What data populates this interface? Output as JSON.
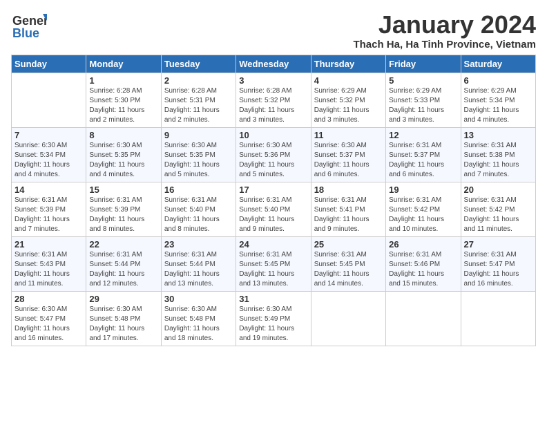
{
  "header": {
    "logo_line1": "General",
    "logo_line2": "Blue",
    "month_title": "January 2024",
    "location": "Thach Ha, Ha Tinh Province, Vietnam"
  },
  "weekdays": [
    "Sunday",
    "Monday",
    "Tuesday",
    "Wednesday",
    "Thursday",
    "Friday",
    "Saturday"
  ],
  "weeks": [
    [
      {
        "day": "",
        "info": ""
      },
      {
        "day": "1",
        "info": "Sunrise: 6:28 AM\nSunset: 5:30 PM\nDaylight: 11 hours\nand 2 minutes."
      },
      {
        "day": "2",
        "info": "Sunrise: 6:28 AM\nSunset: 5:31 PM\nDaylight: 11 hours\nand 2 minutes."
      },
      {
        "day": "3",
        "info": "Sunrise: 6:28 AM\nSunset: 5:32 PM\nDaylight: 11 hours\nand 3 minutes."
      },
      {
        "day": "4",
        "info": "Sunrise: 6:29 AM\nSunset: 5:32 PM\nDaylight: 11 hours\nand 3 minutes."
      },
      {
        "day": "5",
        "info": "Sunrise: 6:29 AM\nSunset: 5:33 PM\nDaylight: 11 hours\nand 3 minutes."
      },
      {
        "day": "6",
        "info": "Sunrise: 6:29 AM\nSunset: 5:34 PM\nDaylight: 11 hours\nand 4 minutes."
      }
    ],
    [
      {
        "day": "7",
        "info": "Sunrise: 6:30 AM\nSunset: 5:34 PM\nDaylight: 11 hours\nand 4 minutes."
      },
      {
        "day": "8",
        "info": "Sunrise: 6:30 AM\nSunset: 5:35 PM\nDaylight: 11 hours\nand 4 minutes."
      },
      {
        "day": "9",
        "info": "Sunrise: 6:30 AM\nSunset: 5:35 PM\nDaylight: 11 hours\nand 5 minutes."
      },
      {
        "day": "10",
        "info": "Sunrise: 6:30 AM\nSunset: 5:36 PM\nDaylight: 11 hours\nand 5 minutes."
      },
      {
        "day": "11",
        "info": "Sunrise: 6:30 AM\nSunset: 5:37 PM\nDaylight: 11 hours\nand 6 minutes."
      },
      {
        "day": "12",
        "info": "Sunrise: 6:31 AM\nSunset: 5:37 PM\nDaylight: 11 hours\nand 6 minutes."
      },
      {
        "day": "13",
        "info": "Sunrise: 6:31 AM\nSunset: 5:38 PM\nDaylight: 11 hours\nand 7 minutes."
      }
    ],
    [
      {
        "day": "14",
        "info": "Sunrise: 6:31 AM\nSunset: 5:39 PM\nDaylight: 11 hours\nand 7 minutes."
      },
      {
        "day": "15",
        "info": "Sunrise: 6:31 AM\nSunset: 5:39 PM\nDaylight: 11 hours\nand 8 minutes."
      },
      {
        "day": "16",
        "info": "Sunrise: 6:31 AM\nSunset: 5:40 PM\nDaylight: 11 hours\nand 8 minutes."
      },
      {
        "day": "17",
        "info": "Sunrise: 6:31 AM\nSunset: 5:40 PM\nDaylight: 11 hours\nand 9 minutes."
      },
      {
        "day": "18",
        "info": "Sunrise: 6:31 AM\nSunset: 5:41 PM\nDaylight: 11 hours\nand 9 minutes."
      },
      {
        "day": "19",
        "info": "Sunrise: 6:31 AM\nSunset: 5:42 PM\nDaylight: 11 hours\nand 10 minutes."
      },
      {
        "day": "20",
        "info": "Sunrise: 6:31 AM\nSunset: 5:42 PM\nDaylight: 11 hours\nand 11 minutes."
      }
    ],
    [
      {
        "day": "21",
        "info": "Sunrise: 6:31 AM\nSunset: 5:43 PM\nDaylight: 11 hours\nand 11 minutes."
      },
      {
        "day": "22",
        "info": "Sunrise: 6:31 AM\nSunset: 5:44 PM\nDaylight: 11 hours\nand 12 minutes."
      },
      {
        "day": "23",
        "info": "Sunrise: 6:31 AM\nSunset: 5:44 PM\nDaylight: 11 hours\nand 13 minutes."
      },
      {
        "day": "24",
        "info": "Sunrise: 6:31 AM\nSunset: 5:45 PM\nDaylight: 11 hours\nand 13 minutes."
      },
      {
        "day": "25",
        "info": "Sunrise: 6:31 AM\nSunset: 5:45 PM\nDaylight: 11 hours\nand 14 minutes."
      },
      {
        "day": "26",
        "info": "Sunrise: 6:31 AM\nSunset: 5:46 PM\nDaylight: 11 hours\nand 15 minutes."
      },
      {
        "day": "27",
        "info": "Sunrise: 6:31 AM\nSunset: 5:47 PM\nDaylight: 11 hours\nand 16 minutes."
      }
    ],
    [
      {
        "day": "28",
        "info": "Sunrise: 6:30 AM\nSunset: 5:47 PM\nDaylight: 11 hours\nand 16 minutes."
      },
      {
        "day": "29",
        "info": "Sunrise: 6:30 AM\nSunset: 5:48 PM\nDaylight: 11 hours\nand 17 minutes."
      },
      {
        "day": "30",
        "info": "Sunrise: 6:30 AM\nSunset: 5:48 PM\nDaylight: 11 hours\nand 18 minutes."
      },
      {
        "day": "31",
        "info": "Sunrise: 6:30 AM\nSunset: 5:49 PM\nDaylight: 11 hours\nand 19 minutes."
      },
      {
        "day": "",
        "info": ""
      },
      {
        "day": "",
        "info": ""
      },
      {
        "day": "",
        "info": ""
      }
    ]
  ]
}
